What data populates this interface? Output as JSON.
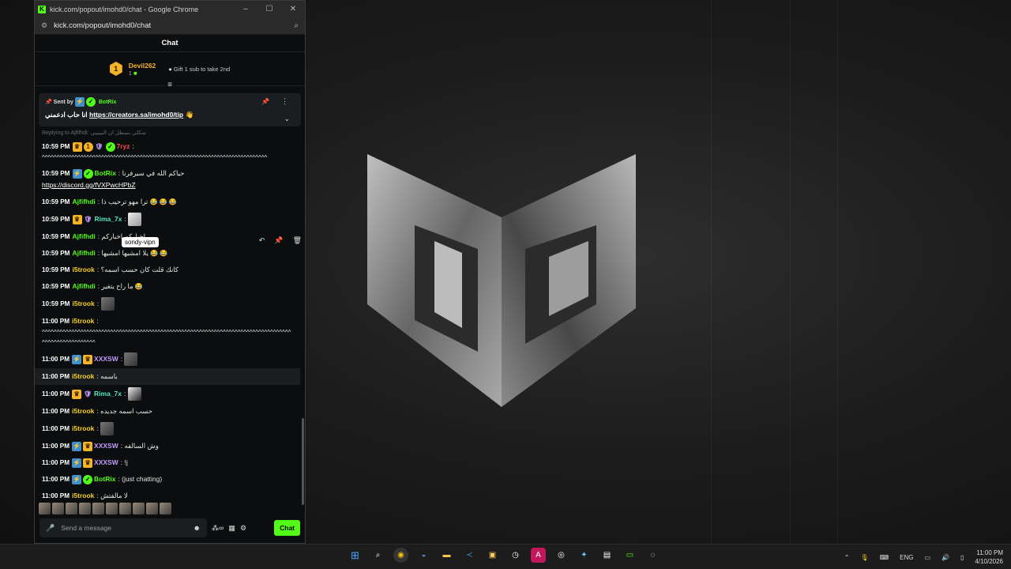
{
  "window": {
    "title": "kick.com/popout/imohd0/chat - Google Chrome",
    "url": "kick.com/popout/imohd0/chat"
  },
  "chat": {
    "header": "Chat",
    "leaderboard": {
      "rank": "1",
      "name": "Devil262",
      "count": "1",
      "gift_text": "Gift 1 sub to take 2nd"
    },
    "pinned": {
      "sent_by_label": "Sent by",
      "sender": "BotRix",
      "text_prefix": "انا حاب ادعمني",
      "link": "https://creators.sa/imohd0/tip"
    },
    "reply_hint": "Replying to Ajfifhdi: شكلي بسطل ان البيبيبي",
    "messages": [
      {
        "time": "10:59 PM",
        "user": "7ryz",
        "text": "^^^^^^^^^^^^^^^^^^^^^^^^^^^^^^^^^^^^^^^^^^^^^^^^^^^^^^^^^^^^^^^^^^^^^^^^^^^^"
      },
      {
        "time": "10:59 PM",
        "user": "BotRix",
        "text": "حياكم الله في سيرفرنا",
        "link": "https://discord.gg/fVXPwcHPbZ"
      },
      {
        "time": "10:59 PM",
        "user": "Ajfifhdi",
        "text": "ترا مهو ترحيب ذا"
      },
      {
        "time": "10:59 PM",
        "user": "Rima_7x",
        "text": ""
      },
      {
        "time": "10:59 PM",
        "user": "Ajfifhdi",
        "text": "اخباركم اخباركم"
      },
      {
        "time": "10:59 PM",
        "user": "Ajfifhdi",
        "text": "يلا امشيها امشيها"
      },
      {
        "time": "10:59 PM",
        "user": "i5trook",
        "text": "كانك قلت كان حسب اسمه؟"
      },
      {
        "time": "10:59 PM",
        "user": "Ajfifhdi",
        "text": "ما راح يتغير"
      },
      {
        "time": "10:59 PM",
        "user": "i5trook",
        "text": ""
      },
      {
        "time": "11:00 PM",
        "user": "i5trook",
        "text": "^^^^^^^^^^^^^^^^^^^^^^^^^^^^^^^^^^^^^^^^^^^^^^^^^^^^^^^^^^^^^^^^^^^^^^^^^^^^^^^^^^^^^^^^^^^^^^^^^^^^^^"
      },
      {
        "time": "11:00 PM",
        "user": "XXXSW",
        "text": ""
      },
      {
        "time": "11:00 PM",
        "user": "i5trook",
        "text": "باسمه"
      },
      {
        "time": "11:00 PM",
        "user": "Rima_7x",
        "text": ""
      },
      {
        "time": "11:00 PM",
        "user": "i5trook",
        "text": "حسب اسمه جديده"
      },
      {
        "time": "11:00 PM",
        "user": "i5trook",
        "text": ""
      },
      {
        "time": "11:00 PM",
        "user": "XXXSW",
        "text": "وش السالفه"
      },
      {
        "time": "11:00 PM",
        "user": "XXXSW",
        "text": "!j"
      },
      {
        "time": "11:00 PM",
        "user": "BotRix",
        "text": "(just chatting)"
      },
      {
        "time": "11:00 PM",
        "user": "i5trook",
        "text": "لا مالفتش"
      }
    ],
    "tooltip": "sondy-vipn",
    "input_placeholder": "Send a message",
    "send_label": "Chat"
  },
  "taskbar": {
    "lang": "ENG",
    "time": "11:00 PM",
    "date": "4/10/2026"
  },
  "colors": {
    "kick_green": "#53fc18",
    "gold": "#f5b326"
  }
}
